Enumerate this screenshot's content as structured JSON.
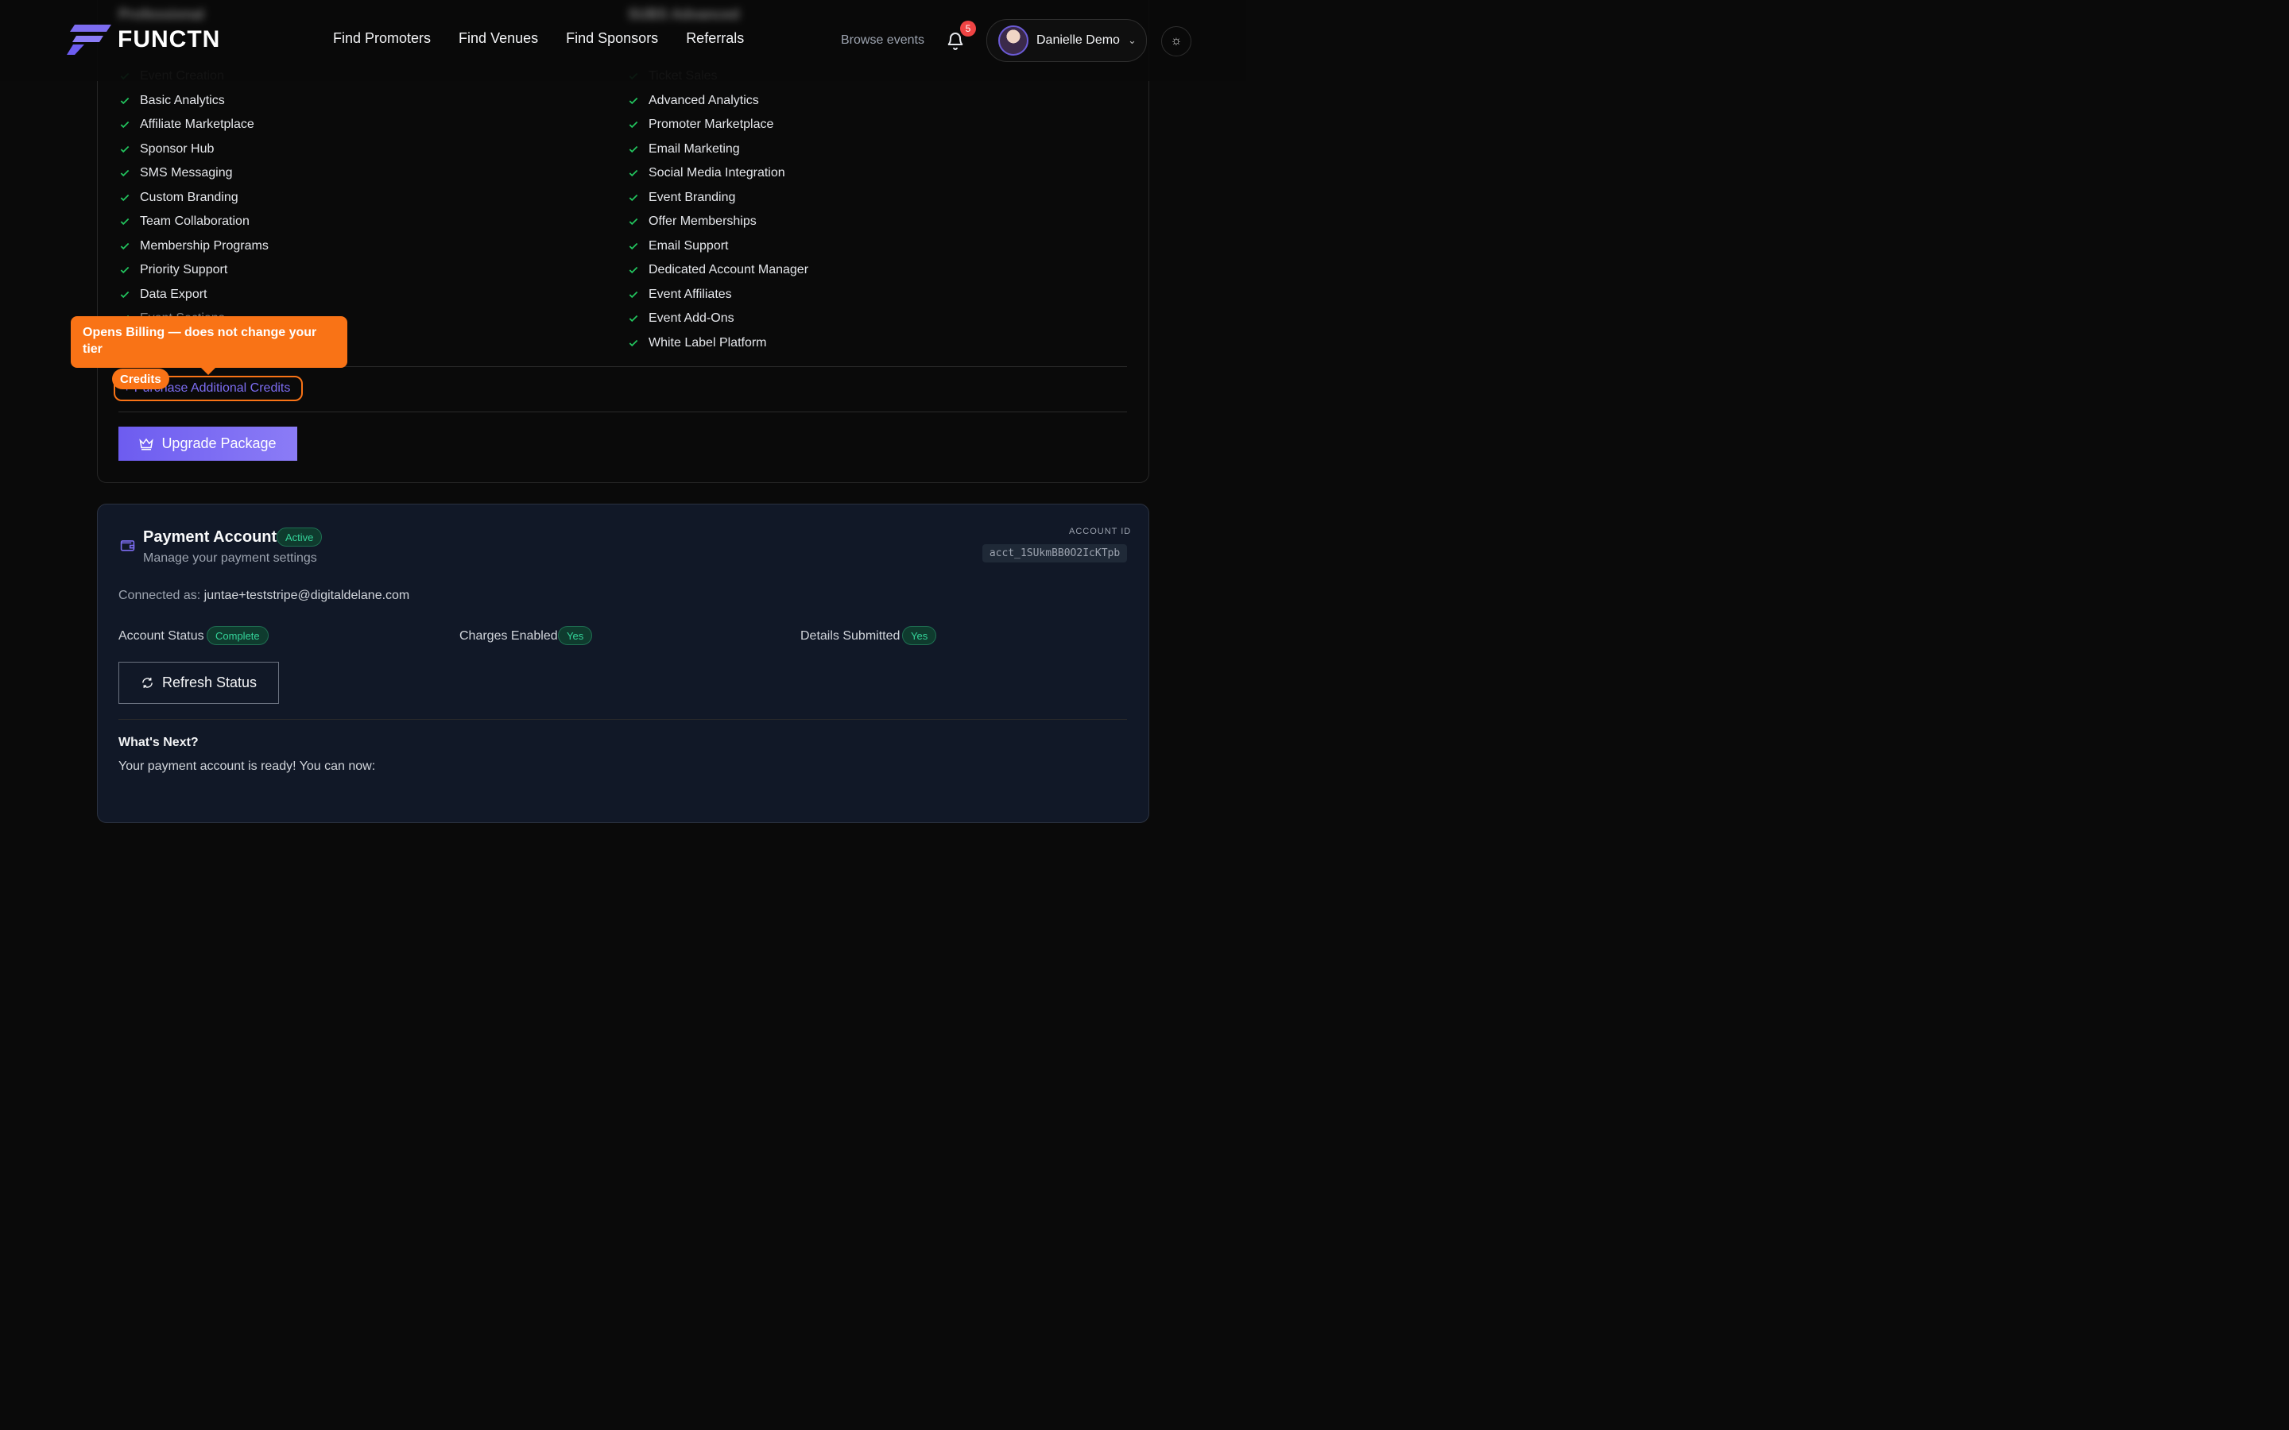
{
  "header": {
    "brand": "FUNCTN",
    "nav": [
      "Find Promoters",
      "Find Venues",
      "Find Sponsors",
      "Referrals"
    ],
    "browse": "Browse events",
    "notifications": "5",
    "user_name": "Danielle Demo"
  },
  "package": {
    "blurred_left": "Professional",
    "blurred_right": "SUBS Advanced",
    "left_features": [
      "Event Creation",
      "Basic Analytics",
      "Affiliate Marketplace",
      "Sponsor Hub",
      "SMS Messaging",
      "Custom Branding",
      "Team Collaboration",
      "Membership Programs",
      "Priority Support",
      "Data Export",
      "Event Sections"
    ],
    "right_features": [
      "Ticket Sales",
      "Advanced Analytics",
      "Promoter Marketplace",
      "Email Marketing",
      "Social Media Integration",
      "Event Branding",
      "Offer Memberships",
      "Email Support",
      "Dedicated Account Manager",
      "Event Affiliates",
      "Event Add-Ons",
      "White Label Platform"
    ],
    "credits_link": "+ Purchase Additional Credits",
    "credits_tag": "Credits",
    "tooltip": "Opens Billing — does not change your tier",
    "upgrade": "Upgrade Package"
  },
  "payment": {
    "title": "Payment Account",
    "active": "Active",
    "subtitle": "Manage your payment settings",
    "account_id_label": "ACCOUNT ID",
    "account_id": "acct_1SUkmBB0O2IcKTpb",
    "connected_label": "Connected as:",
    "connected_email": "juntae+teststripe@digitaldelane.com",
    "account_status_label": "Account Status",
    "account_status": "Complete",
    "charges_label": "Charges Enabled",
    "charges": "Yes",
    "details_label": "Details Submitted",
    "details": "Yes",
    "refresh": "Refresh Status",
    "next_title": "What's Next?",
    "next_text": "Your payment account is ready! You can now:"
  },
  "colors": {
    "accent": "#7c6cf0",
    "orange": "#f97316",
    "green": "#22c55e"
  }
}
